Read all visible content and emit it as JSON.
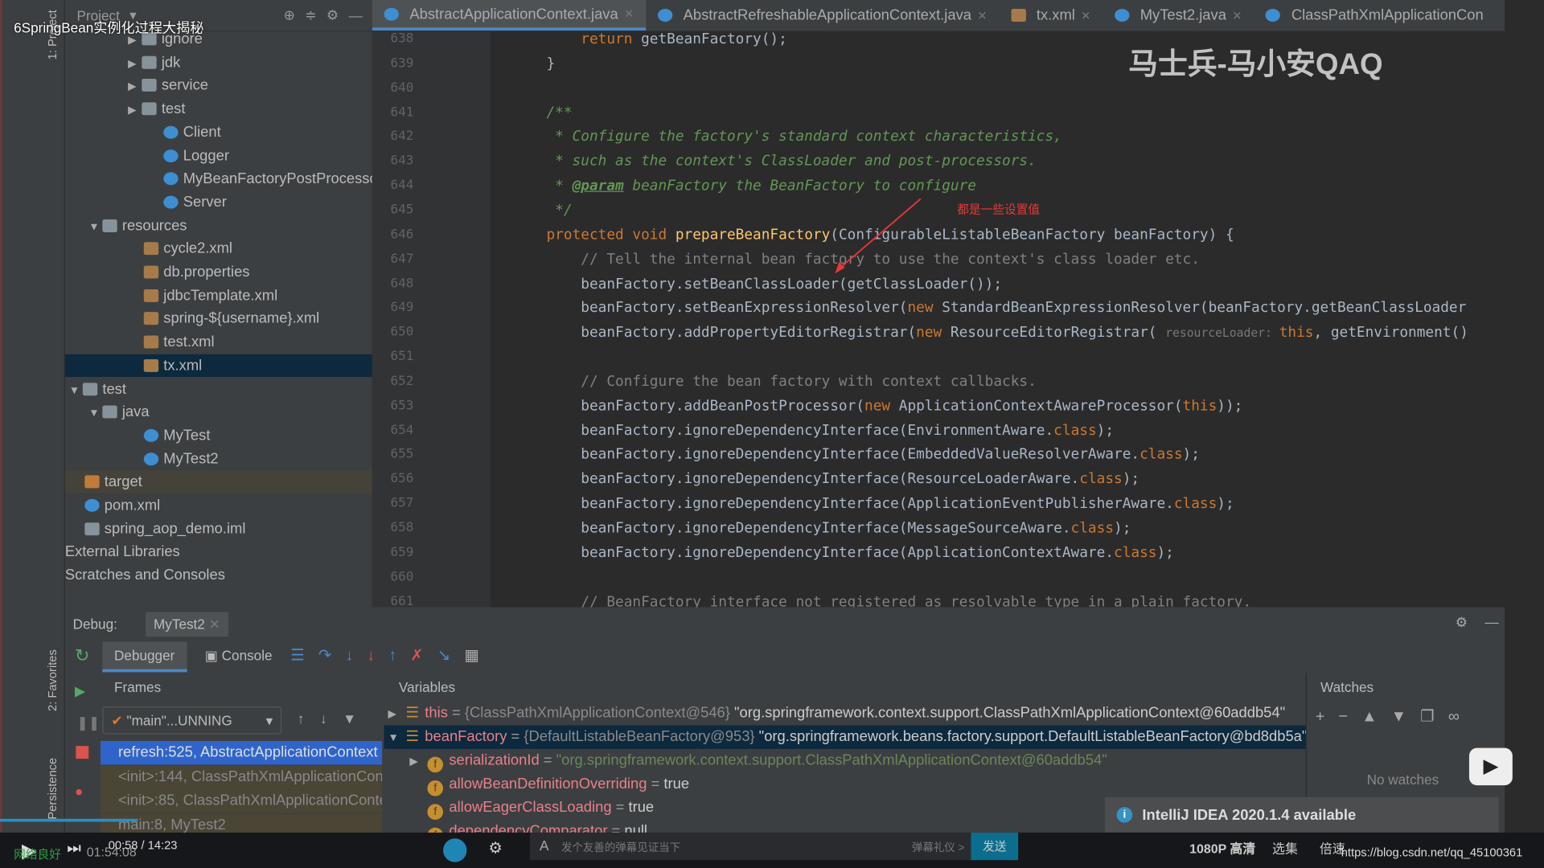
{
  "video_title": "6SpringBean实例化过程大揭秘",
  "watermark": "马士兵-马小安QAQ",
  "tool_windows": {
    "project": "1: Project",
    "favorites": "2: Favorites",
    "persistence": "Persistence"
  },
  "project_header": {
    "title": "Project"
  },
  "tree": [
    {
      "label": "ignore",
      "icon": "folder-icon",
      "depth": 3,
      "arrow": "▶"
    },
    {
      "label": "jdk",
      "icon": "folder-icon",
      "depth": 3,
      "arrow": "▶"
    },
    {
      "label": "service",
      "icon": "folder-icon",
      "depth": 3,
      "arrow": "▶"
    },
    {
      "label": "test",
      "icon": "folder-icon",
      "depth": 3,
      "arrow": "▶"
    },
    {
      "label": "Client",
      "icon": "class-icon",
      "depth": 4
    },
    {
      "label": "Logger",
      "icon": "class-icon",
      "depth": 4
    },
    {
      "label": "MyBeanFactoryPostProcessor",
      "icon": "class-icon",
      "depth": 4
    },
    {
      "label": "Server",
      "icon": "class-icon",
      "depth": 4
    },
    {
      "label": "resources",
      "icon": "folder-icon",
      "depth": 1,
      "arrow": "▼"
    },
    {
      "label": "cycle2.xml",
      "icon": "xml-file-icon",
      "depth": 3
    },
    {
      "label": "db.properties",
      "icon": "xml-file-icon",
      "depth": 3
    },
    {
      "label": "jdbcTemplate.xml",
      "icon": "xml-file-icon",
      "depth": 3
    },
    {
      "label": "spring-${username}.xml",
      "icon": "xml-file-icon",
      "depth": 3
    },
    {
      "label": "test.xml",
      "icon": "xml-file-icon",
      "depth": 3
    },
    {
      "label": "tx.xml",
      "icon": "xml-file-icon",
      "depth": 3,
      "selected": true
    },
    {
      "label": "test",
      "icon": "folder-icon",
      "depth": 0,
      "arrow": "▼"
    },
    {
      "label": "java",
      "icon": "folder-icon",
      "depth": 1,
      "arrow": "▼"
    },
    {
      "label": "MyTest",
      "icon": "class-icon",
      "depth": 3
    },
    {
      "label": "MyTest2",
      "icon": "class-icon",
      "depth": 3
    },
    {
      "label": "target",
      "icon": "target-folder-icon",
      "depth": 0,
      "highlight": true
    },
    {
      "label": "pom.xml",
      "icon": "maven-icon",
      "depth": 0
    },
    {
      "label": "spring_aop_demo.iml",
      "icon": "module-file-icon",
      "depth": 0
    },
    {
      "label": "External Libraries",
      "icon": "",
      "depth": -1
    },
    {
      "label": "Scratches and Consoles",
      "icon": "",
      "depth": -1
    }
  ],
  "tabs": [
    {
      "label": "AbstractApplicationContext.java",
      "active": true
    },
    {
      "label": "AbstractRefreshableApplicationContext.java"
    },
    {
      "label": "tx.xml"
    },
    {
      "label": "MyTest2.java"
    },
    {
      "label": "ClassPathXmlApplicationCon"
    }
  ],
  "code": [
    {
      "n": "638",
      "s": [
        [
          "        ",
          ""
        ],
        [
          "return ",
          "k"
        ],
        [
          "getBeanFactory();",
          ""
        ]
      ]
    },
    {
      "n": "639",
      "s": [
        [
          "    }",
          ""
        ]
      ]
    },
    {
      "n": "640",
      "s": []
    },
    {
      "n": "641",
      "s": [
        [
          "    /**",
          "d"
        ]
      ]
    },
    {
      "n": "642",
      "s": [
        [
          "     * Configure the factory's standard context characteristics,",
          "d"
        ]
      ]
    },
    {
      "n": "643",
      "s": [
        [
          "     * such as the context's ClassLoader and post-processors.",
          "d"
        ]
      ]
    },
    {
      "n": "644",
      "s": [
        [
          "     * ",
          "d"
        ],
        [
          "@param",
          "dt"
        ],
        [
          " beanFactory the BeanFactory to configure",
          "d"
        ]
      ]
    },
    {
      "n": "645",
      "s": [
        [
          "     */",
          "d"
        ]
      ]
    },
    {
      "n": "646",
      "s": [
        [
          "    ",
          ""
        ],
        [
          "protected void ",
          "k"
        ],
        [
          "prepareBeanFactory",
          "f"
        ],
        [
          "(ConfigurableListableBeanFactory beanFactory) {",
          ""
        ]
      ]
    },
    {
      "n": "647",
      "s": [
        [
          "        // Tell the internal bean factory to use the context's class loader etc.",
          "c"
        ]
      ]
    },
    {
      "n": "648",
      "s": [
        [
          "        beanFactory.setBeanClassLoader(getClassLoader());",
          ""
        ]
      ]
    },
    {
      "n": "649",
      "s": [
        [
          "        beanFactory.setBeanExpressionResolver(",
          ""
        ],
        [
          "new ",
          "k"
        ],
        [
          "StandardBeanExpressionResolver(beanFactory.getBeanClassLoader",
          ""
        ]
      ]
    },
    {
      "n": "650",
      "s": [
        [
          "        beanFactory.addPropertyEditorRegistrar(",
          ""
        ],
        [
          "new ",
          "k"
        ],
        [
          "ResourceEditorRegistrar( ",
          ""
        ],
        [
          "resourceLoader: ",
          "h"
        ],
        [
          "this",
          "k"
        ],
        [
          ", getEnvironment()",
          ""
        ]
      ]
    },
    {
      "n": "651",
      "s": []
    },
    {
      "n": "652",
      "s": [
        [
          "        // Configure the bean factory with context callbacks.",
          "c"
        ]
      ]
    },
    {
      "n": "653",
      "s": [
        [
          "        beanFactory.addBeanPostProcessor(",
          ""
        ],
        [
          "new ",
          "k"
        ],
        [
          "ApplicationContextAwareProcessor(",
          ""
        ],
        [
          "this",
          "k"
        ],
        [
          "));",
          ""
        ]
      ]
    },
    {
      "n": "654",
      "s": [
        [
          "        beanFactory.ignoreDependencyInterface(EnvironmentAware.",
          ""
        ],
        [
          "class",
          "k"
        ],
        [
          ");",
          ""
        ]
      ]
    },
    {
      "n": "655",
      "s": [
        [
          "        beanFactory.ignoreDependencyInterface(EmbeddedValueResolverAware.",
          ""
        ],
        [
          "class",
          "k"
        ],
        [
          ");",
          ""
        ]
      ]
    },
    {
      "n": "656",
      "s": [
        [
          "        beanFactory.ignoreDependencyInterface(ResourceLoaderAware.",
          ""
        ],
        [
          "class",
          "k"
        ],
        [
          ");",
          ""
        ]
      ]
    },
    {
      "n": "657",
      "s": [
        [
          "        beanFactory.ignoreDependencyInterface(ApplicationEventPublisherAware.",
          ""
        ],
        [
          "class",
          "k"
        ],
        [
          ");",
          ""
        ]
      ]
    },
    {
      "n": "658",
      "s": [
        [
          "        beanFactory.ignoreDependencyInterface(MessageSourceAware.",
          ""
        ],
        [
          "class",
          "k"
        ],
        [
          ");",
          ""
        ]
      ]
    },
    {
      "n": "659",
      "s": [
        [
          "        beanFactory.ignoreDependencyInterface(ApplicationContextAware.",
          ""
        ],
        [
          "class",
          "k"
        ],
        [
          ");",
          ""
        ]
      ]
    },
    {
      "n": "660",
      "s": []
    },
    {
      "n": "661",
      "s": [
        [
          "        // BeanFactory interface not registered as resolvable type in a plain factory.",
          "c"
        ]
      ]
    }
  ],
  "annotation": "都是一些设置值",
  "debug": {
    "label": "Debug:",
    "config": "MyTest2",
    "tab_debugger": "Debugger",
    "tab_console": "Console",
    "frames_label": "Frames",
    "variables_label": "Variables",
    "watches_label": "Watches",
    "thread": "\"main\"...UNNING",
    "no_watches": "No watches",
    "frames": [
      {
        "label": "refresh:525, AbstractApplicationContext",
        "selected": true
      },
      {
        "label": "<init>:144, ClassPathXmlApplicationContext"
      },
      {
        "label": "<init>:85, ClassPathXmlApplicationContext"
      },
      {
        "label": "main:8, MyTest2"
      }
    ],
    "variables": [
      {
        "arrow": "▶",
        "icon": "object-icon",
        "name": "this",
        "ref": "{ClassPathXmlApplicationContext@546}",
        "value": "\"org.springframework.context.support.ClassPathXmlApplicationContext@60addb54\""
      },
      {
        "arrow": "▼",
        "icon": "object-icon",
        "name": "beanFactory",
        "ref": "{DefaultListableBeanFactory@953}",
        "value": "\"org.springframework.beans.factory.support.DefaultListableBeanFactory@bd8db5a\"",
        "selected": true
      },
      {
        "arrow": "▶",
        "icon": "field-icon",
        "name": "serializationId",
        "ref": "",
        "value": "\"org.springframework.context.support.ClassPathXmlApplicationContext@60addb54\"",
        "indent": true,
        "string": true
      },
      {
        "arrow": "",
        "icon": "field-icon",
        "name": "allowBeanDefinitionOverriding",
        "ref": "",
        "value": "true",
        "indent": true
      },
      {
        "arrow": "",
        "icon": "field-icon",
        "name": "allowEagerClassLoading",
        "ref": "",
        "value": "true",
        "indent": true
      },
      {
        "arrow": "",
        "icon": "field-icon",
        "name": "dependencyComparator",
        "ref": "",
        "value": "null",
        "indent": true
      }
    ]
  },
  "notification": "IntelliJ IDEA 2020.1.4 available",
  "player": {
    "time": "00:58 / 14:23",
    "network": "网络良好",
    "elapsed": "01:54:08",
    "danmaku_placeholder": "发个友善的弹幕见证当下",
    "etiquette": "弹幕礼仪 >",
    "send": "发送",
    "quality": "1080P 高清",
    "episodes": "选集",
    "speed": "倍速",
    "url_watermark": "https://blog.csdn.net/qq_45100361"
  },
  "colors": {
    "accent": "#4a88c7",
    "selection": "#0d293e",
    "frame_selected": "#2f65ca",
    "send_button": "#0b6e8e"
  }
}
